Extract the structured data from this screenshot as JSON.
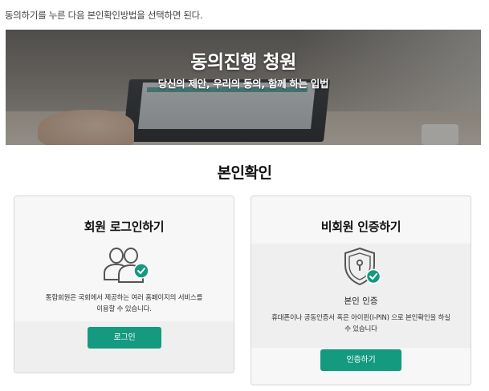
{
  "intro_text": "동의하기를 누른 다음 본인확인방법을 선택하면 된다.",
  "banner": {
    "title": "동의진행 청원",
    "subtitle": "당신의 제안, 우리의 동의, 함께 하는 입법"
  },
  "section_title": "본인확인",
  "member_card": {
    "title": "회원 로그인하기",
    "icon": "users-check-icon",
    "description_line1": "통합회원은 국회에서 제공하는 여러 홈페이지의 서비스를",
    "description_line2": "이용할 수 있습니다.",
    "button_label": "로그인"
  },
  "guest_card": {
    "title": "비회원 인증하기",
    "icon": "shield-lock-check-icon",
    "label": "본인 인증",
    "description_line1": "휴대폰이나 공동인증서 혹은 아이핀(I-PIN) 으로 본인확인을 하실",
    "description_line2": "수 있습니다",
    "button_label": "인증하기"
  },
  "colors": {
    "accent": "#139a7f",
    "card_bg": "#f7f7f7",
    "card_band": "#efefef",
    "icon_stroke": "#555555"
  }
}
